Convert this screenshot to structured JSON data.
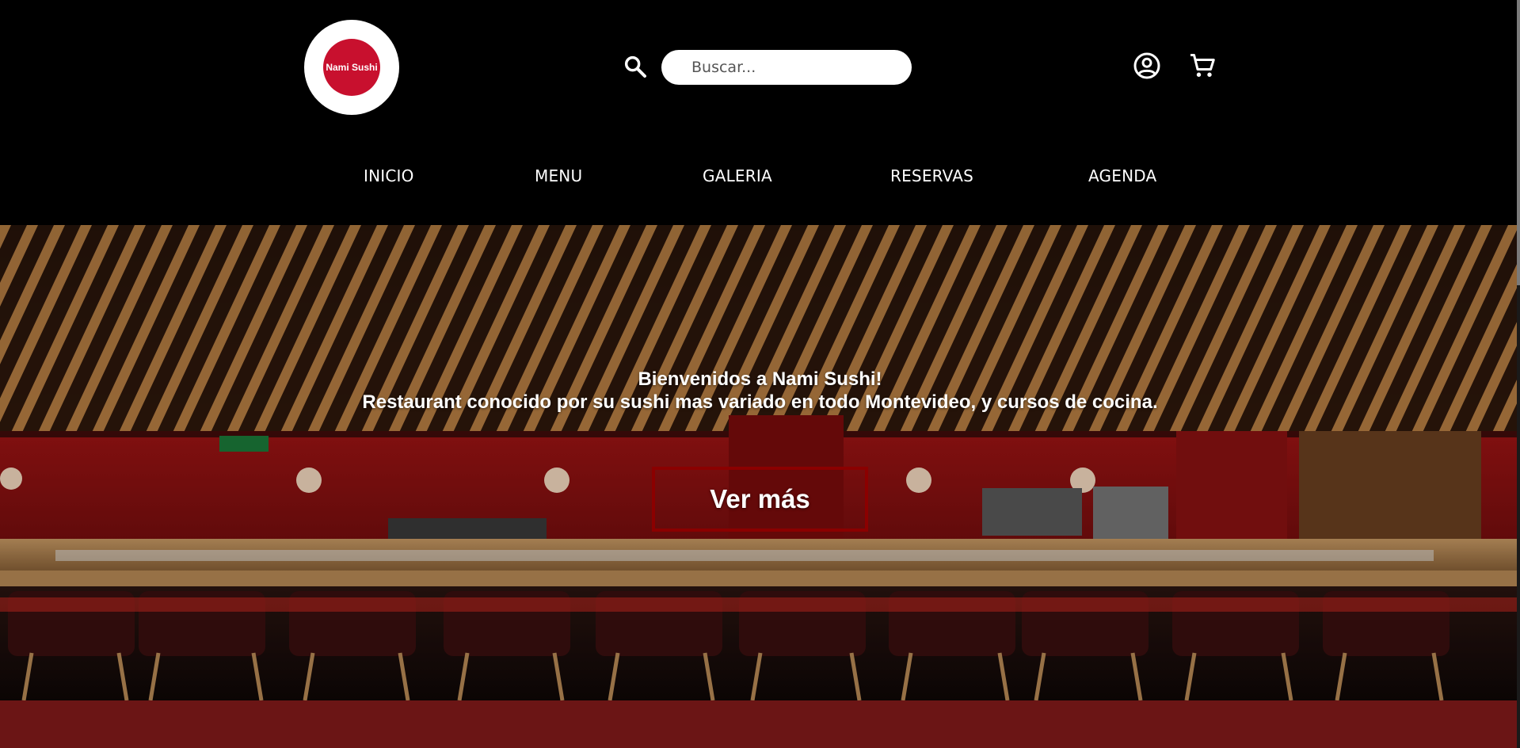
{
  "header": {
    "logo_text": "Nami Sushi",
    "search": {
      "placeholder": "Buscar...",
      "value": ""
    },
    "icons": {
      "search": "search-icon",
      "account": "account-circle-icon",
      "cart": "shopping-cart-icon"
    }
  },
  "nav": {
    "items": [
      {
        "label": "INICIO"
      },
      {
        "label": "MENU"
      },
      {
        "label": "GALERIA"
      },
      {
        "label": "RESERVAS"
      },
      {
        "label": "AGENDA"
      }
    ]
  },
  "hero": {
    "line1": "Bienvenidos a Nami Sushi!",
    "line2": "Restaurant conocido por su sushi mas variado en todo Montevideo, y cursos de cocina.",
    "cta_label": "Ver más"
  },
  "colors": {
    "header_bg": "#000000",
    "logo_red": "#c8102e",
    "cta_border": "#8b0000",
    "bottom_strip": "#6b1515"
  }
}
